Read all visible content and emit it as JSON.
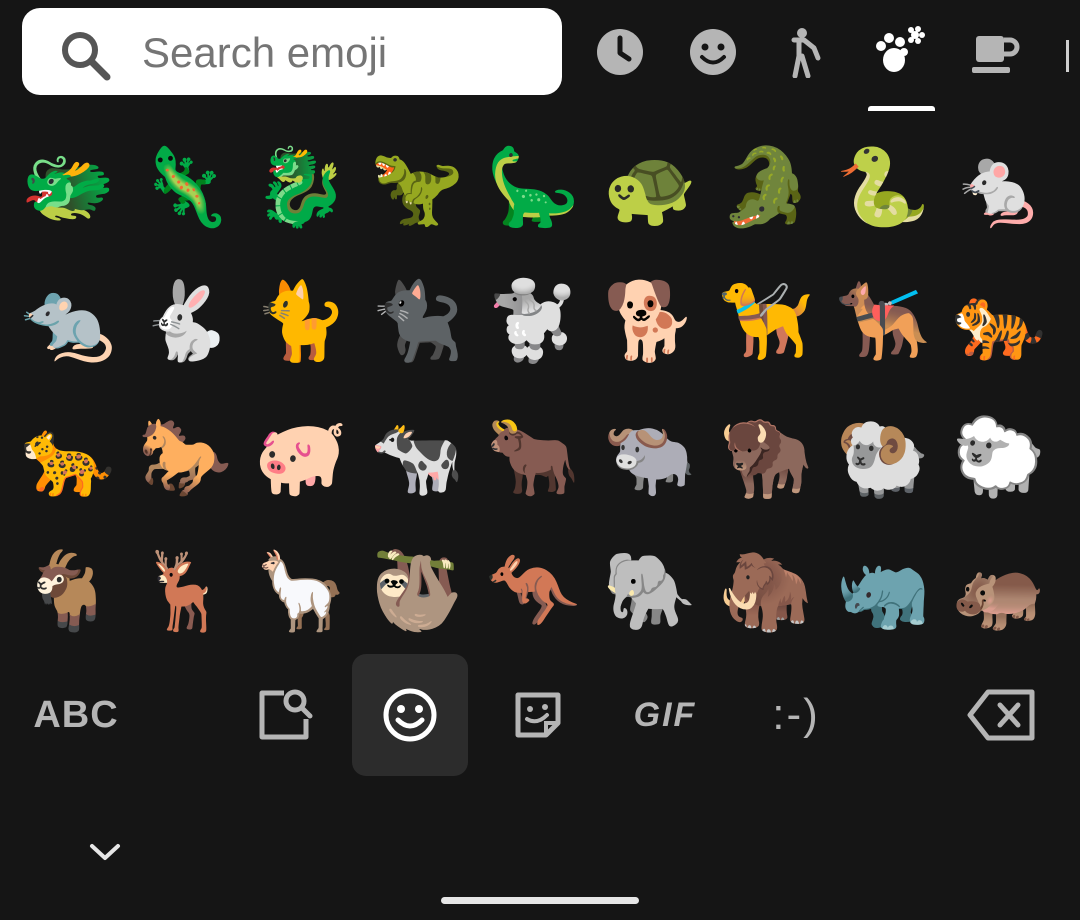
{
  "search": {
    "placeholder": "Search emoji",
    "value": ""
  },
  "categories": [
    {
      "name": "recent",
      "icon": "clock-icon",
      "selected": false
    },
    {
      "name": "smileys",
      "icon": "smiley-icon",
      "selected": false
    },
    {
      "name": "people",
      "icon": "person-icon",
      "selected": false
    },
    {
      "name": "animals-nature",
      "icon": "paw-flower-icon",
      "selected": true
    },
    {
      "name": "food-drink",
      "icon": "coffee-cup-icon",
      "selected": false
    }
  ],
  "emoji_rows": [
    [
      "🐲",
      "🦎",
      "🐉",
      "🦖",
      "🦕",
      "🐢",
      "🐊",
      "🐍",
      "🐁"
    ],
    [
      "🐀",
      "🐇",
      "🐈",
      "🐈‍⬛",
      "🐩",
      "🐕",
      "🦮",
      "🐕‍🦺",
      "🐅"
    ],
    [
      "🐆",
      "🐎",
      "🐖",
      "🐄",
      "🐂",
      "🐃",
      "🦬",
      "🐏",
      "🐑"
    ],
    [
      "🐐",
      "🦌",
      "🦙",
      "🦥",
      "🦘",
      "🐘",
      "🦣",
      "🦏",
      "🦛"
    ]
  ],
  "bottom_bar": {
    "abc_label": "ABC",
    "gif_label": "GIF",
    "emoticon_label": ":-)",
    "active": "emoji"
  },
  "colors": {
    "background": "#151515",
    "icon_gray": "#b5b5b5",
    "selected": "#ffffff",
    "active_tab_bg": "#2c2c2c"
  }
}
